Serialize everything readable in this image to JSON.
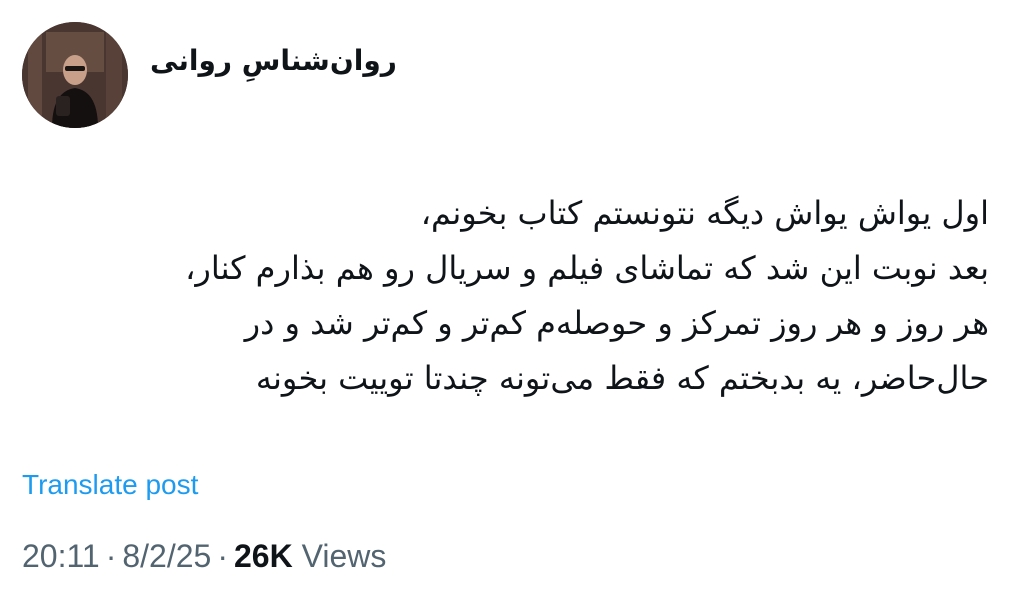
{
  "author": {
    "display_name": "روان‌شناسِ روانی"
  },
  "post": {
    "lines": [
      "اول یواش یواش دیگه نتونستم کتاب بخونم،",
      "بعد نوبت این شد که تماشای فیلم و سریال رو هم بذارم کنار،",
      "هر روز و هر روز تمرکز و حوصله‌م کم‌تر و کم‌تر شد و در",
      "حال‌حاضر، یه بدبختم که فقط می‌تونه چندتا توییت بخونه"
    ]
  },
  "actions": {
    "translate_label": "Translate post"
  },
  "meta": {
    "time": "20:11",
    "separator": "·",
    "date": "8/2/25",
    "views_count": "26K",
    "views_label": "Views"
  },
  "colors": {
    "link": "#1d9bf0",
    "secondary_text": "#536471",
    "primary_text": "#0f1419",
    "background": "#ffffff"
  }
}
